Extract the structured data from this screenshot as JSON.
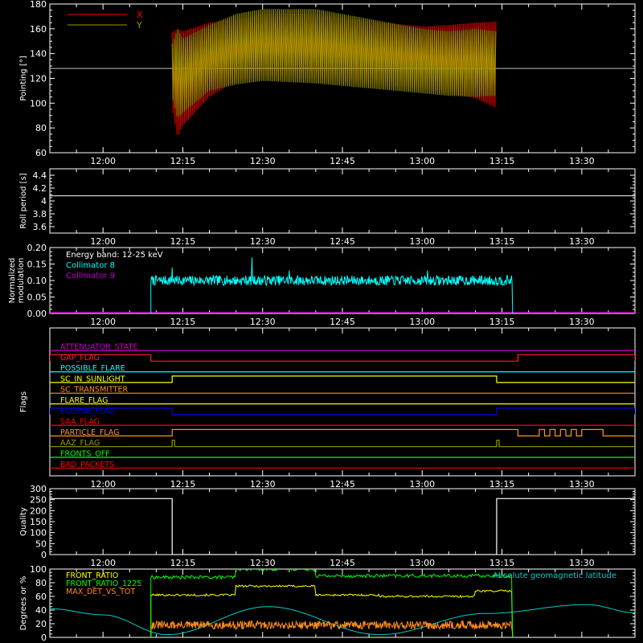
{
  "chart_data": [
    {
      "id": "pointing",
      "type": "line",
      "ylabel": "Pointing [°]",
      "ylim": [
        60,
        180
      ],
      "yticks": [
        60,
        80,
        100,
        120,
        140,
        160,
        180
      ],
      "xlim": [
        "11:50",
        "13:40"
      ],
      "xticks": [
        "12:00",
        "12:15",
        "12:30",
        "12:45",
        "13:00",
        "13:15",
        "13:30"
      ],
      "reference_line": 128,
      "legend_placement": "top-left",
      "series": [
        {
          "name": "X",
          "color": "#ff0000",
          "x": [
            "12:13",
            "12:14",
            "12:15",
            "12:20",
            "12:25",
            "12:30",
            "12:40",
            "12:50",
            "13:00",
            "13:05",
            "13:10",
            "13:14"
          ],
          "upper": [
            157,
            160,
            158,
            165,
            168,
            172,
            172,
            166,
            162,
            163,
            165,
            166
          ],
          "lower": [
            96,
            72,
            82,
            105,
            118,
            122,
            120,
            116,
            112,
            108,
            104,
            96
          ]
        },
        {
          "name": "Y",
          "color": "#a09a00",
          "x": [
            "12:13",
            "12:14",
            "12:15",
            "12:20",
            "12:25",
            "12:30",
            "12:40",
            "12:50",
            "13:00",
            "13:05",
            "13:10",
            "13:14"
          ],
          "upper": [
            148,
            160,
            152,
            163,
            172,
            176,
            176,
            168,
            160,
            158,
            160,
            158
          ],
          "lower": [
            105,
            88,
            92,
            110,
            115,
            118,
            116,
            112,
            108,
            106,
            105,
            106
          ]
        }
      ]
    },
    {
      "id": "roll-period",
      "type": "line",
      "ylabel": "Roll period [s]",
      "ylim": [
        3.5,
        4.5
      ],
      "yticks": [
        3.6,
        3.8,
        4.0,
        4.2,
        4.4
      ],
      "xlim": [
        "11:50",
        "13:40"
      ],
      "xticks": [
        "12:00",
        "12:15",
        "12:30",
        "12:45",
        "13:00",
        "13:15",
        "13:30"
      ],
      "series": [
        {
          "color": "#ffffff",
          "x": [
            "11:50",
            "13:40"
          ],
          "values": [
            4.08,
            4.08
          ]
        }
      ]
    },
    {
      "id": "modulation",
      "type": "line",
      "ylabel": "Normalized modulation",
      "ylim": [
        0,
        0.2
      ],
      "yticks": [
        0.0,
        0.05,
        0.1,
        0.15,
        0.2
      ],
      "ytick_labels": [
        "0.00",
        "0.05",
        "0.10",
        "0.15",
        "0.20"
      ],
      "xlim": [
        "11:50",
        "13:40"
      ],
      "xticks": [
        "12:00",
        "12:15",
        "12:30",
        "12:45",
        "13:00",
        "13:15",
        "13:30"
      ],
      "annotation": "Energy band: 12-25 keV",
      "legend_placement": "top-left",
      "series": [
        {
          "name": "Collimator 8",
          "color": "#00ffff",
          "x": [
            "12:09",
            "13:17"
          ],
          "level": 0.1,
          "noise": 0.015,
          "peaks": [
            [
              "12:28",
              0.17
            ],
            [
              "12:13",
              0.14
            ],
            [
              "12:35",
              0.13
            ],
            [
              "13:01",
              0.13
            ]
          ]
        },
        {
          "name": "Collimator 9",
          "color": "#cc00cc",
          "x": [
            "11:50",
            "13:40"
          ],
          "values": [
            0,
            0
          ]
        }
      ]
    },
    {
      "id": "flags",
      "type": "line",
      "ylabel": "Flags",
      "xlim": [
        "11:50",
        "13:40"
      ],
      "xticks": [
        "12:00",
        "12:15",
        "12:30",
        "12:45",
        "13:00",
        "13:15",
        "13:30"
      ],
      "flags": [
        {
          "name": "ATTENUATOR_STATE",
          "color": "#cc00cc",
          "segments": []
        },
        {
          "name": "GAP_FLAG",
          "color": "#ff2020",
          "segments": [
            [
              "11:50",
              "12:09"
            ],
            [
              "13:18",
              "13:40"
            ]
          ]
        },
        {
          "name": "POSSIBLE_FLARE",
          "color": "#00ffff",
          "segments": []
        },
        {
          "name": "SC_IN_SUNLIGHT",
          "color": "#ffff00",
          "segments": [
            [
              "12:13",
              "13:14"
            ]
          ]
        },
        {
          "name": "SC_TRANSMITTER",
          "color": "#ff9020",
          "segments": []
        },
        {
          "name": "FLARE_FLAG",
          "color": "#ffff00",
          "segments": []
        },
        {
          "name": "ECLIPSE_FLAG",
          "color": "#0000ff",
          "segments": [
            [
              "11:50",
              "12:13"
            ],
            [
              "13:14",
              "13:40"
            ]
          ]
        },
        {
          "name": "SAA_FLAG",
          "color": "#ff0000",
          "segments": []
        },
        {
          "name": "PARTICLE_FLAG",
          "color": "#ff9020",
          "segments": [
            [
              "12:13",
              "13:18"
            ],
            [
              "13:22",
              "13:23"
            ],
            [
              "13:24",
              "13:25"
            ],
            [
              "13:26",
              "13:27"
            ],
            [
              "13:28",
              "13:29"
            ],
            [
              "13:30",
              "13:34"
            ]
          ]
        },
        {
          "name": "AAZ_FLAG",
          "color": "#999900",
          "segments": [
            [
              "12:13",
              "12:13"
            ],
            [
              "13:14",
              "13:14"
            ]
          ]
        },
        {
          "name": "FRONTS_OFF",
          "color": "#00ff00",
          "segments": []
        },
        {
          "name": "BAD_PACKETS",
          "color": "#ff0000",
          "segments": []
        }
      ]
    },
    {
      "id": "quality",
      "type": "line",
      "ylabel": "Quality",
      "ylim": [
        0,
        300
      ],
      "yticks": [
        0,
        50,
        100,
        150,
        200,
        250,
        300
      ],
      "xlim": [
        "11:50",
        "13:40"
      ],
      "xticks": [
        "12:00",
        "12:15",
        "12:30",
        "12:45",
        "13:00",
        "13:15",
        "13:30"
      ],
      "series": [
        {
          "color": "#ffffff",
          "x": [
            "11:50",
            "12:13",
            "12:13",
            "13:14",
            "13:14",
            "13:40"
          ],
          "values": [
            255,
            255,
            0,
            0,
            255,
            255
          ]
        }
      ]
    },
    {
      "id": "front-ratio",
      "type": "line",
      "ylabel": "Degrees or %",
      "ylim": [
        0,
        100
      ],
      "yticks": [
        0,
        20,
        40,
        60,
        80,
        100
      ],
      "xlim": [
        "11:50",
        "13:40"
      ],
      "legend_placement": "top-left",
      "series": [
        {
          "name": "FRONT_RATIO",
          "color": "#ffff00",
          "x": [
            "12:09",
            "12:25",
            "12:25",
            "12:40",
            "12:40",
            "12:52",
            "12:52",
            "13:10",
            "13:10",
            "13:17"
          ],
          "values": [
            62,
            62,
            75,
            75,
            62,
            62,
            60,
            60,
            68,
            68
          ],
          "noise": 1.5
        },
        {
          "name": "FRONT_RATIO_1225",
          "color": "#00ff00",
          "x": [
            "12:09",
            "12:25",
            "12:25",
            "12:40",
            "12:40",
            "13:17"
          ],
          "values": [
            88,
            88,
            100,
            100,
            90,
            90
          ],
          "noise": 2.5
        },
        {
          "name": "MAX_DET_VS_TOT",
          "color": "#ff8c1a",
          "x": [
            "12:09",
            "13:17"
          ],
          "level": 18,
          "noise": 6
        },
        {
          "name": "Absolute geomagnetic latitude",
          "color": "#00cccc",
          "x": [
            "11:50",
            "12:00",
            "12:12",
            "12:31",
            "12:52",
            "13:12",
            "13:31",
            "13:40"
          ],
          "values": [
            42,
            33,
            4,
            45,
            4,
            35,
            48,
            36
          ]
        }
      ]
    }
  ]
}
